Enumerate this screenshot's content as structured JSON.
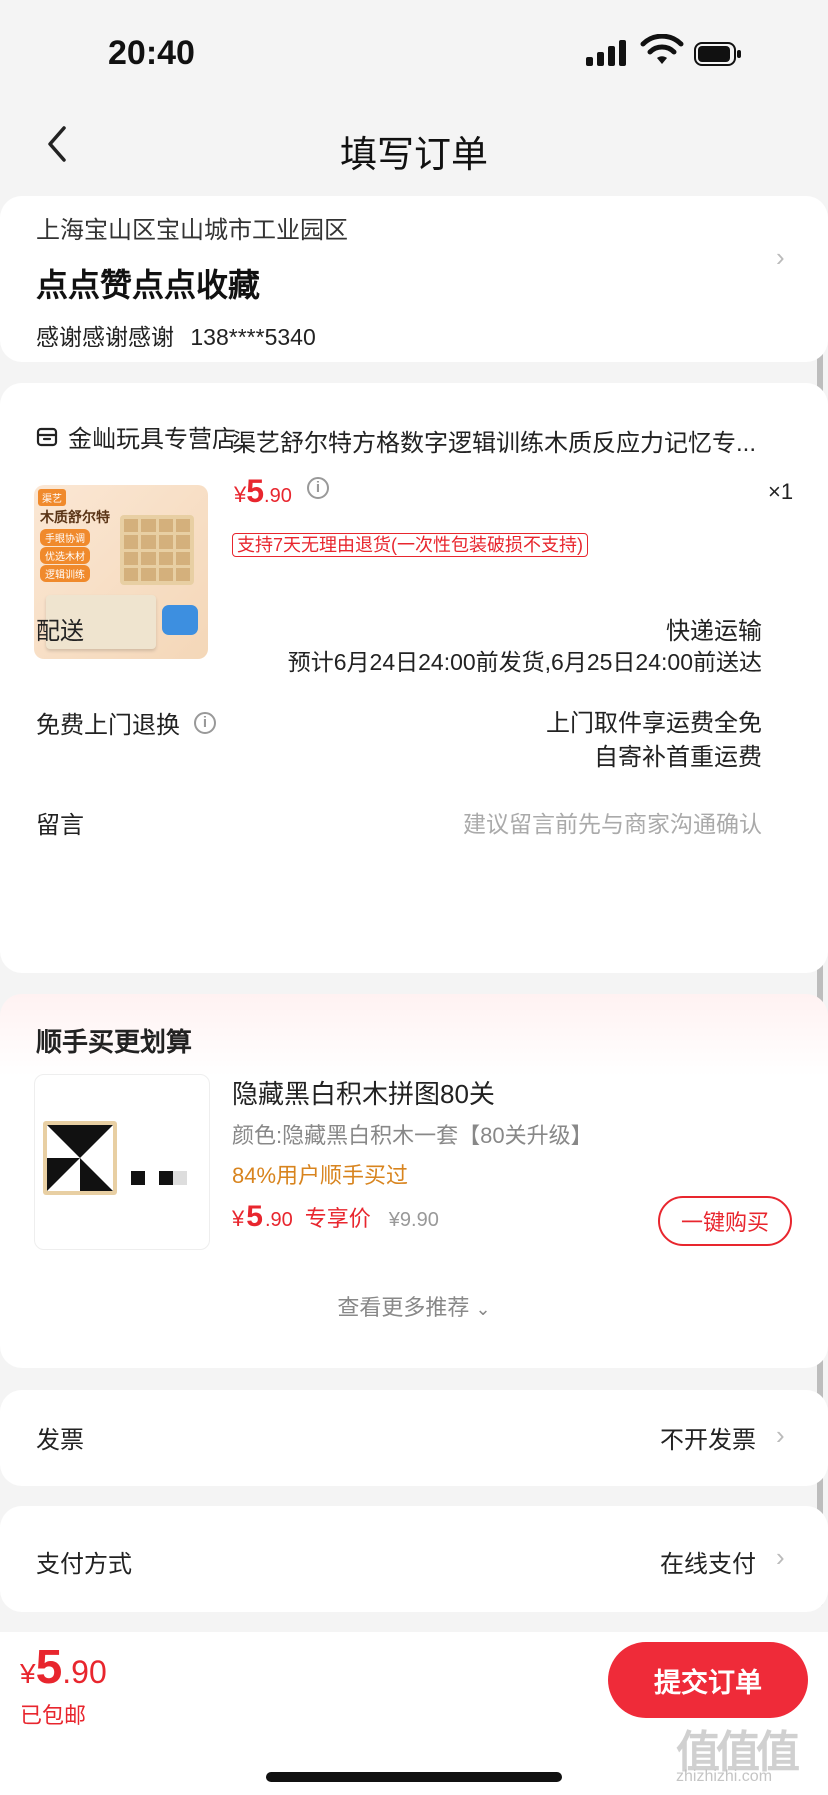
{
  "status_bar": {
    "time": "20:40"
  },
  "nav": {
    "title": "填写订单"
  },
  "address": {
    "region": "上海宝山区宝山城市工业园区",
    "detail": "点点赞点点收藏",
    "name": "感谢感谢感谢",
    "phone": "138****5340"
  },
  "store": {
    "name": "金屾玩具专营店",
    "product": {
      "title": "渠艺舒尔特方格数字逻辑训练木质反应力记忆专...",
      "price_symbol": "¥",
      "price_int": "5",
      "price_dec": ".90",
      "qty": "×1",
      "return_badge": "支持7天无理由退货(一次性包装破损不支持)",
      "image_texts": {
        "brand": "渠艺",
        "title": "木质舒尔特",
        "tag1": "手眼协调",
        "tag2": "优选木材",
        "tag3": "逻辑训练"
      }
    },
    "shipping": {
      "label": "配送",
      "method": "快递运输",
      "eta": "预计6月24日24:00前发货,6月25日24:00前送达"
    },
    "returns": {
      "label": "免费上门退换",
      "line1": "上门取件享运费全免",
      "line2": "自寄补首重运费"
    },
    "message": {
      "label": "留言",
      "placeholder": "建议留言前先与商家沟通确认"
    }
  },
  "addon": {
    "title": "顺手买更划算",
    "item": {
      "name": "隐藏黑白积木拼图80关",
      "spec": "颜色:隐藏黑白积木一套【80关升级】",
      "social": "84%用户顺手买过",
      "price_symbol": "¥",
      "price_int": "5",
      "price_dec": ".90",
      "price_tag": "专享价",
      "orig_price": "¥9.90",
      "buy_button": "一键购买"
    },
    "more": "查看更多推荐"
  },
  "invoice": {
    "label": "发票",
    "value": "不开发票"
  },
  "payment": {
    "label": "支付方式",
    "value": "在线支付"
  },
  "footer": {
    "total_symbol": "¥",
    "total_int": "5",
    "total_dec": ".90",
    "shipping_note": "已包邮",
    "submit": "提交订单"
  },
  "watermark": {
    "text": "值值值",
    "url": "zhizhizhi.com"
  },
  "colors": {
    "accent": "#e8262e",
    "submit_bg": "#ef2b39",
    "social_orange": "#d8841e"
  }
}
